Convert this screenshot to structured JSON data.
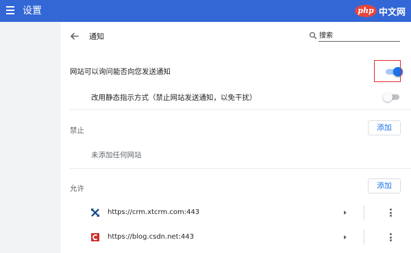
{
  "header": {
    "title": "设置",
    "menu_icon": "hamburger-menu-icon",
    "watermark_logo": "php",
    "watermark_text": "中文网",
    "color": "#3367d6"
  },
  "page": {
    "back_icon": "arrow-left-icon",
    "title": "通知",
    "search": {
      "icon": "search-icon",
      "placeholder": "搜索",
      "value": ""
    }
  },
  "settings": {
    "ask_to_send": {
      "label": "网站可以询问能否向您发送通知",
      "enabled": true
    },
    "quieter_messaging": {
      "label": "改用静态指示方式（禁止网站发送通知，以免干扰）",
      "enabled": false
    }
  },
  "block": {
    "heading": "禁止",
    "add_label": "添加",
    "empty_text": "未添加任何网站"
  },
  "allow": {
    "heading": "允许",
    "add_label": "添加",
    "sites": [
      {
        "url": "https://crm.xtcrm.com:443",
        "favicon": "xtcrm-favicon",
        "arrow_icon": "play-arrow-icon",
        "more_icon": "more-vert-icon"
      },
      {
        "url": "https://blog.csdn.net:443",
        "favicon": "csdn-favicon",
        "arrow_icon": "play-arrow-icon",
        "more_icon": "more-vert-icon"
      }
    ]
  },
  "colors": {
    "accent": "#1a73e8",
    "highlight": "#e3242b",
    "background": "#f1f3f4"
  }
}
